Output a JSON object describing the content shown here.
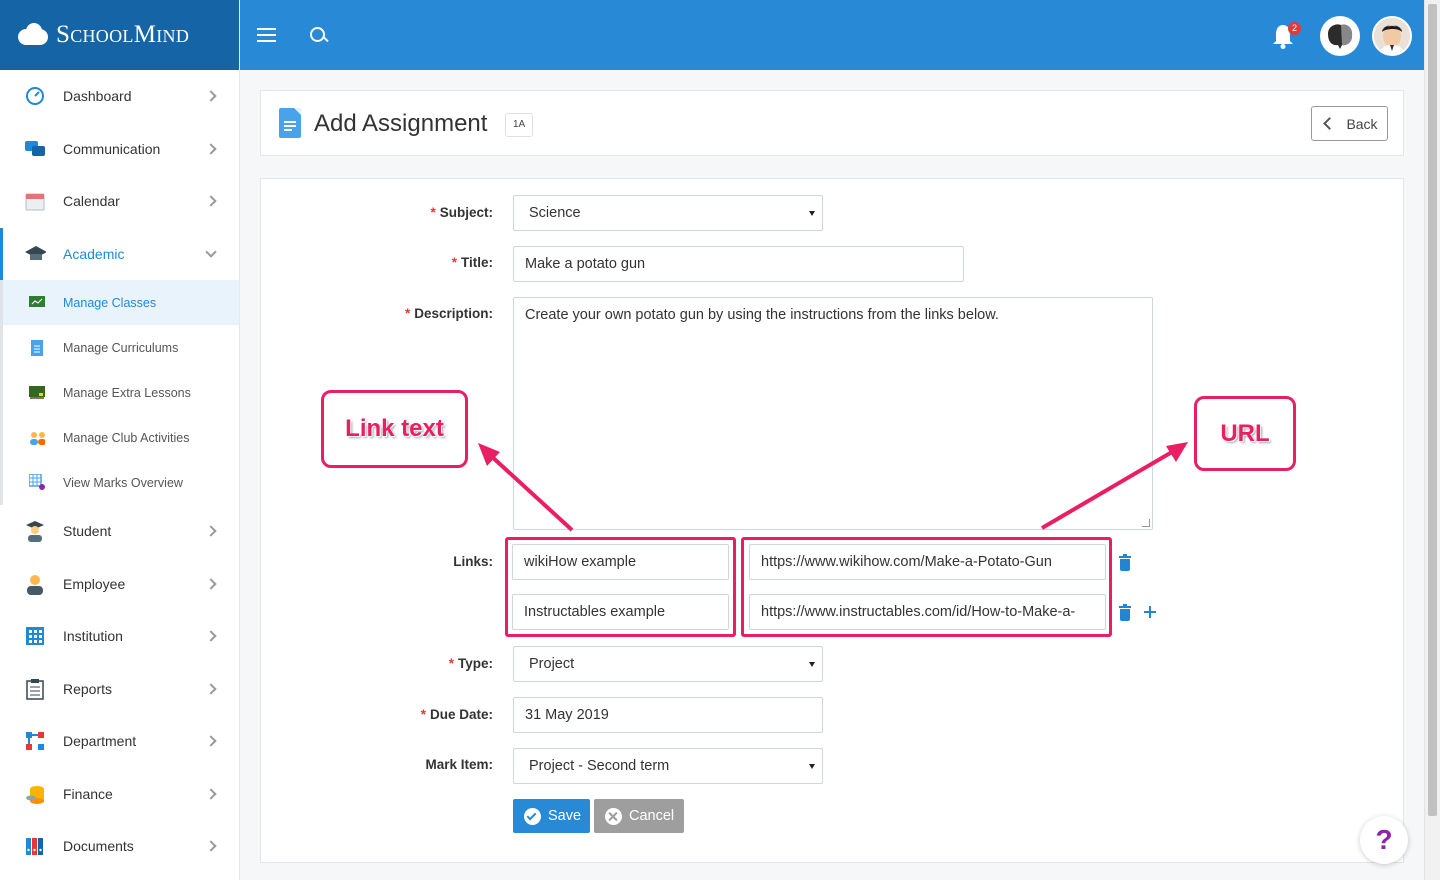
{
  "brand": {
    "name": "SchoolMind"
  },
  "topbar": {
    "notification_count": "2"
  },
  "sidebar": {
    "items": [
      {
        "label": "Dashboard"
      },
      {
        "label": "Communication"
      },
      {
        "label": "Calendar"
      },
      {
        "label": "Academic"
      },
      {
        "label": "Student"
      },
      {
        "label": "Employee"
      },
      {
        "label": "Institution"
      },
      {
        "label": "Reports"
      },
      {
        "label": "Department"
      },
      {
        "label": "Finance"
      },
      {
        "label": "Documents"
      }
    ],
    "academic_sub": [
      {
        "label": "Manage Classes"
      },
      {
        "label": "Manage Curriculums"
      },
      {
        "label": "Manage Extra Lessons"
      },
      {
        "label": "Manage Club Activities"
      },
      {
        "label": "View Marks Overview"
      }
    ]
  },
  "header": {
    "title": "Add Assignment",
    "class_badge": "1A",
    "back_label": "Back"
  },
  "form": {
    "subject_label": "Subject:",
    "subject_value": "Science",
    "title_label": "Title:",
    "title_value": "Make a potato gun",
    "description_label": "Description:",
    "description_value": "Create your own potato gun by using the instructions from the links below.",
    "links_label": "Links:",
    "links": [
      {
        "text": "wikiHow example",
        "url": "https://www.wikihow.com/Make-a-Potato-Gun"
      },
      {
        "text": "Instructables example",
        "url": "https://www.instructables.com/id/How-to-Make-a-"
      }
    ],
    "type_label": "Type:",
    "type_value": "Project",
    "due_date_label": "Due Date:",
    "due_date_value": "31 May 2019",
    "mark_item_label": "Mark Item:",
    "mark_item_value": "Project - Second term",
    "save_label": "Save",
    "cancel_label": "Cancel"
  },
  "annotations": {
    "link_text": "Link  text",
    "url": "URL"
  },
  "help": {
    "glyph": "?"
  },
  "colors": {
    "primary": "#2889d6",
    "brand_bar": "#1565a6",
    "annotation": "#e91e63",
    "required": "#e53935"
  }
}
